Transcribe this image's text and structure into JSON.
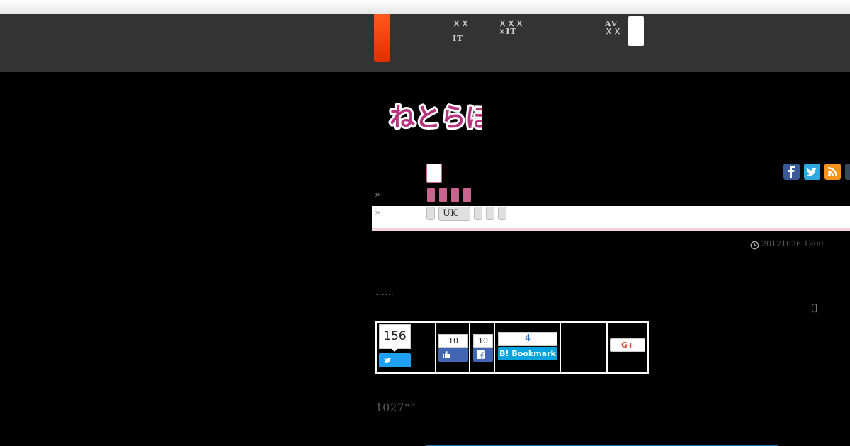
{
  "header": {
    "nav_items": [
      {
        "line1": "ＸＸ",
        "line2": "IT"
      },
      {
        "line1": "ＸＸＸ",
        "line2": "×IT"
      },
      {
        "line1": "AV",
        "line2": "ＸＸ"
      }
    ]
  },
  "logo": {
    "text": "ねとらぼ",
    "color": "#b8347e"
  },
  "breadcrumb": {
    "raquo1": "»",
    "raquo2": "»"
  },
  "tags": {
    "uk_label": "UK"
  },
  "article": {
    "timestamp": "20171026 1300",
    "dots": "……",
    "bracket": "[]",
    "subheading": "1027“”"
  },
  "share": {
    "tweet_count": "156",
    "like_count": "10",
    "fb_share_count": "10",
    "hatena_count": "4",
    "hatena_label": "Bookmark",
    "hatena_prefix": "B!",
    "gplus_label": "G+"
  },
  "colors": {
    "accent_orange": "#f04010",
    "header_bg": "#333333",
    "pink": "#c9648e",
    "twitter_blue": "#1da1f2",
    "facebook_blue": "#4267b2",
    "hatena_blue": "#00a4de",
    "gplus_red": "#dd4b39"
  },
  "icons": [
    "facebook-icon",
    "twitter-icon",
    "rss-icon",
    "tumblr-icon",
    "clock-icon"
  ]
}
